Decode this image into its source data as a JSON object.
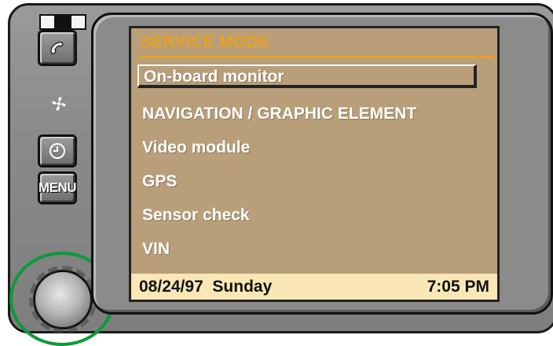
{
  "device": {
    "indicator": [
      "off",
      "on",
      "off"
    ]
  },
  "buttons": {
    "phone_icon": "phone-icon",
    "fan_icon": "fan-icon",
    "clock_icon": "clock-icon",
    "menu_label": "MENU"
  },
  "screen": {
    "title": "SERVICE MODE",
    "items": [
      {
        "label": "On-board monitor",
        "selected": true
      },
      {
        "label": "NAVIGATION / GRAPHIC ELEMENT",
        "selected": false
      },
      {
        "label": "Video module",
        "selected": false
      },
      {
        "label": "GPS",
        "selected": false
      },
      {
        "label": "Sensor check",
        "selected": false
      },
      {
        "label": "VIN",
        "selected": false
      }
    ],
    "status": {
      "date": "08/24/97",
      "day": "Sunday",
      "time": "7:05 PM"
    }
  },
  "colors": {
    "screen_bg": "#b89e79",
    "title_accent": "#e8a11f",
    "status_bg": "#f9e8b6",
    "knob_highlight_ring": "#0c9a3a"
  }
}
